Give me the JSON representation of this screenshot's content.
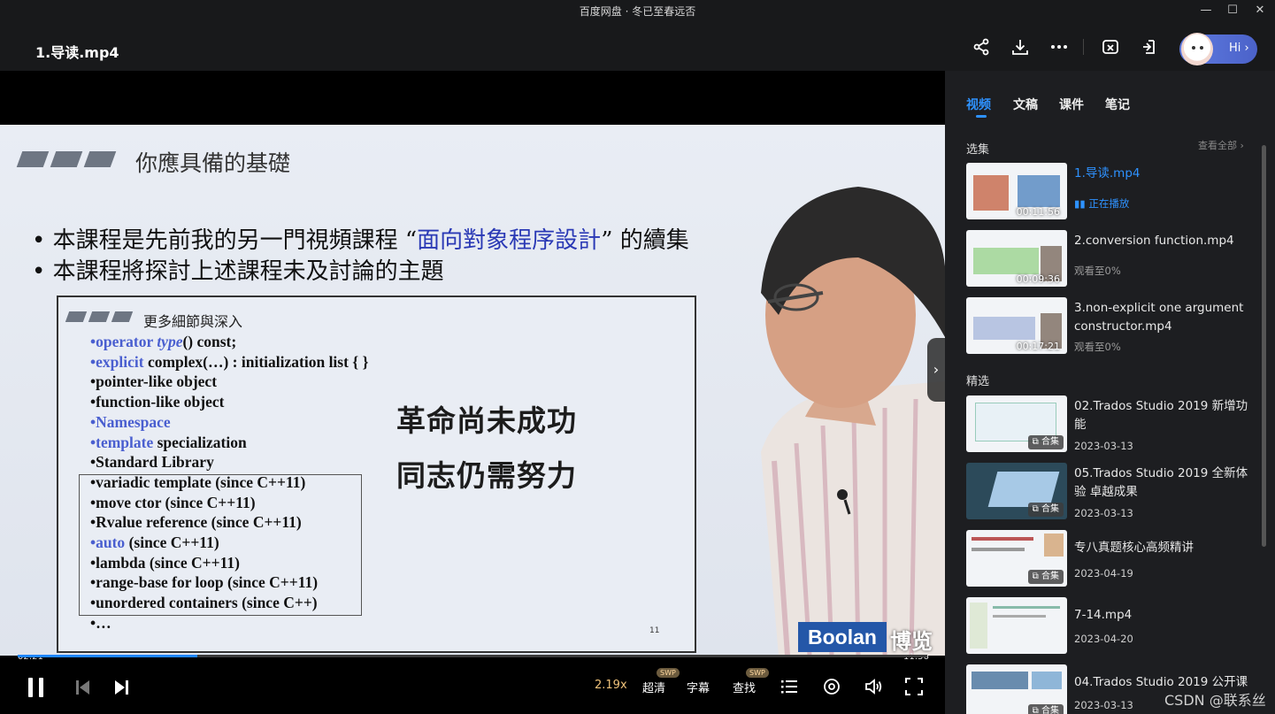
{
  "window": {
    "title": "百度网盘 · 冬已至春远否",
    "minimize_label": "—",
    "maximize_label": "☐",
    "close_label": "✕"
  },
  "header": {
    "file_title": "1.导读.mp4",
    "icons": [
      "share-icon",
      "download-icon",
      "more-icon",
      "screenshot-icon",
      "pip-icon"
    ],
    "assistant_label": "Hi"
  },
  "slide": {
    "title": "你應具備的基礎",
    "bullet1_prefix": "• 本課程是先前我的另一門視頻課程 “",
    "bullet1_highlight": "面向對象程序設計",
    "bullet1_suffix": "” 的續集",
    "bullet2": "• 本課程將探討上述課程未及討論的主題",
    "inner_title": "更多細節與深入",
    "items": [
      {
        "blue": "•operator ",
        "italic": "type",
        "rest": "() const;"
      },
      {
        "blue": "•explicit ",
        "italic": "",
        "rest": "complex(…) : initialization list { }"
      },
      {
        "blue": "",
        "italic": "",
        "rest": "•pointer-like object"
      },
      {
        "blue": "",
        "italic": "",
        "rest": "•function-like object"
      },
      {
        "blue": "•Namespace",
        "italic": "",
        "rest": ""
      },
      {
        "blue": "•template ",
        "italic": "",
        "rest": "specialization"
      },
      {
        "blue": "",
        "italic": "",
        "rest": "•Standard Library"
      },
      {
        "blue": "",
        "italic": "",
        "rest": "•variadic template (since C++11)"
      },
      {
        "blue": "",
        "italic": "",
        "rest": "•move ctor (since C++11)"
      },
      {
        "blue": "",
        "italic": "",
        "rest": "•Rvalue reference (since C++11)"
      },
      {
        "blue": "•auto ",
        "italic": "",
        "rest": "(since C++11)"
      },
      {
        "blue": "",
        "italic": "",
        "rest": "•lambda (since C++11)"
      },
      {
        "blue": "",
        "italic": "",
        "rest": "•range-base for loop (since C++11)"
      },
      {
        "blue": "",
        "italic": "",
        "rest": "•unordered containers (since C++)"
      },
      {
        "blue": "",
        "italic": "",
        "rest": "•…"
      }
    ],
    "page_number": "11",
    "caption1": "革命尚未成功",
    "caption2": "同志仍需努力",
    "logo_en": "Boolan",
    "logo_cn": "博览"
  },
  "player": {
    "current_time": "02:21",
    "duration": "11:56",
    "progress_fraction": 0.197,
    "speed": "2.19x",
    "quality": "超清",
    "subtitle": "字幕",
    "search": "查找",
    "swp_badge": "SWP"
  },
  "panel": {
    "tabs": [
      "视频",
      "文稿",
      "课件",
      "笔记"
    ],
    "section_episodes": "选集",
    "see_all": "查看全部",
    "section_featured": "精选",
    "episodes": [
      {
        "name": "1.导读.mp4",
        "duration": "00:11:56",
        "status": "正在播放",
        "active": true
      },
      {
        "name": "2.conversion function.mp4",
        "duration": "00:09:36",
        "status": "观看至0%",
        "active": false
      },
      {
        "name": "3.non-explicit one argument constructor.mp4",
        "duration": "00:17:21",
        "status": "观看至0%",
        "active": false
      }
    ],
    "featured": [
      {
        "name": "02.Trados Studio 2019 新增功能",
        "date": "2023-03-13",
        "badge": "合集"
      },
      {
        "name": "05.Trados Studio 2019 全新体验 卓越成果",
        "date": "2023-03-13",
        "badge": "合集"
      },
      {
        "name": "专八真题核心高频精讲",
        "date": "2023-04-19",
        "badge": "合集"
      },
      {
        "name": "7-14.mp4",
        "date": "2023-04-20",
        "badge": ""
      },
      {
        "name": "04.Trados Studio 2019 公开课",
        "date": "2023-03-13",
        "badge": "合集"
      }
    ]
  },
  "watermark": "CSDN @联系丝信",
  "colors": {
    "accent": "#2e92ff",
    "background": "#111214",
    "panel": "#1d1e21"
  }
}
